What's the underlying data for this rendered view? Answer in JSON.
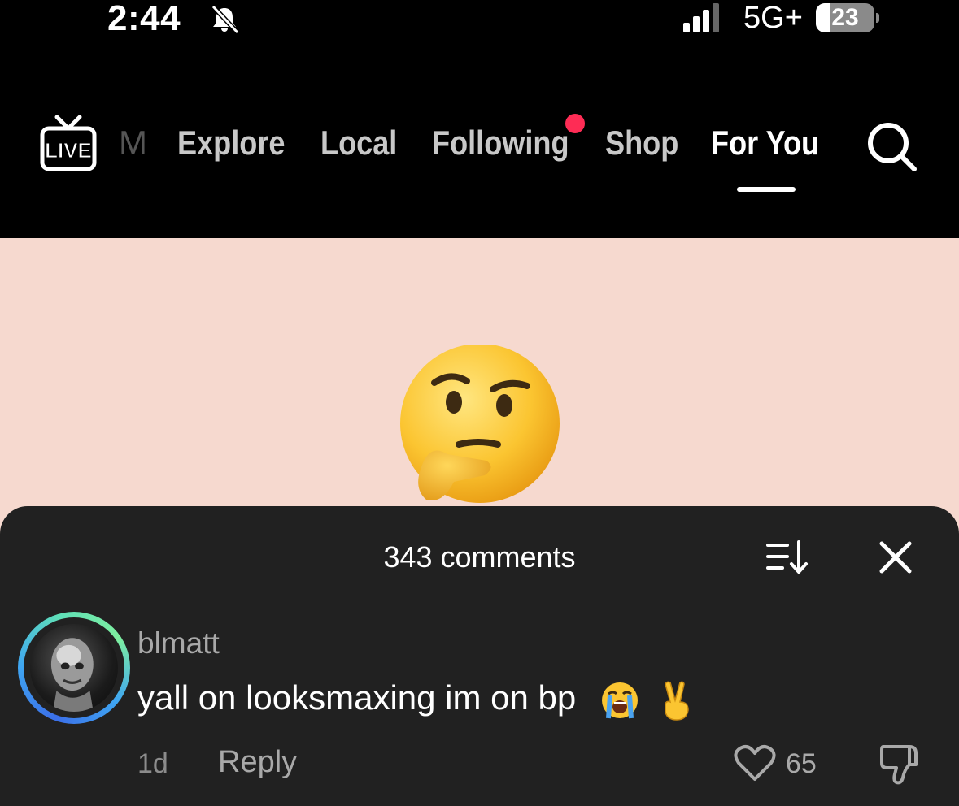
{
  "status_bar": {
    "time": "2:44",
    "network": "5G+",
    "battery": "23",
    "icons": [
      "bell-slash-icon",
      "signal-icon",
      "battery-icon"
    ]
  },
  "nav": {
    "live_label": "LIVE",
    "tabs": [
      {
        "label": "M"
      },
      {
        "label": "Explore"
      },
      {
        "label": "Local"
      },
      {
        "label": "Following"
      },
      {
        "label": "Shop"
      },
      {
        "label": "For You"
      }
    ],
    "active_tab": "For You",
    "notification_dot_color": "#fe2c55"
  },
  "video": {
    "background_color": "#f6d9cf",
    "emoji": "thinking-face-icon"
  },
  "comments": {
    "title": "343 comments",
    "items": [
      {
        "username": "blmatt",
        "text": "yall on looksmaxing im on bp",
        "emojis": [
          "loudly-crying-face-icon",
          "victory-hand-icon"
        ],
        "time": "1d",
        "reply_label": "Reply",
        "likes": "65"
      }
    ]
  },
  "colors": {
    "sheet_background": "#212121",
    "accent": "#fe2c55"
  }
}
